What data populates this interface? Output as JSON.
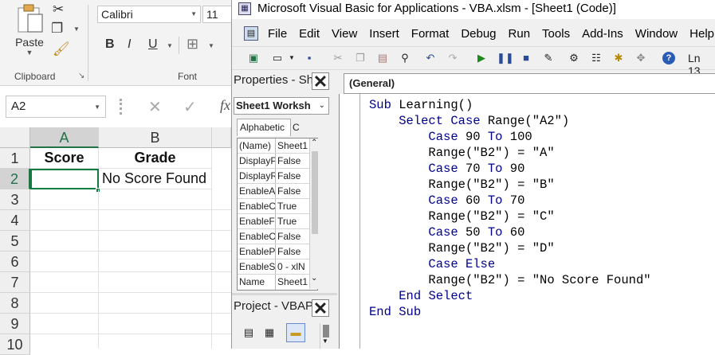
{
  "excel": {
    "clipboard_group": "Clipboard",
    "font_group": "Font",
    "paste_label": "Paste",
    "font_name": "Calibri",
    "font_size": "11",
    "name_box": "A2",
    "fx": "fx",
    "columns": [
      "A",
      "B"
    ],
    "rows": [
      "1",
      "2",
      "3",
      "4",
      "5",
      "6",
      "7",
      "8",
      "9",
      "10"
    ],
    "cells": {
      "A1": "Score",
      "B1": "Grade",
      "A2": "",
      "B2": "No Score Found"
    }
  },
  "vba": {
    "title": "Microsoft Visual Basic for Applications - VBA.xlsm - [Sheet1 (Code)]",
    "menus": [
      "File",
      "Edit",
      "View",
      "Insert",
      "Format",
      "Debug",
      "Run",
      "Tools",
      "Add-Ins",
      "Window",
      "Help"
    ],
    "status": "Ln 13",
    "properties_title": "Properties - Sh",
    "object_selector": "Sheet1 Worksh",
    "tabs": [
      "Alphabetic",
      "C"
    ],
    "properties": [
      {
        "name": "(Name)",
        "value": "Sheet1"
      },
      {
        "name": "DisplayP",
        "value": "False"
      },
      {
        "name": "DisplayR",
        "value": "False"
      },
      {
        "name": "EnableA",
        "value": "False"
      },
      {
        "name": "EnableC",
        "value": "True"
      },
      {
        "name": "EnableF",
        "value": "True"
      },
      {
        "name": "EnableO",
        "value": "False"
      },
      {
        "name": "EnableP",
        "value": "False"
      },
      {
        "name": "EnableS",
        "value": "0 - xlN"
      },
      {
        "name": "Name",
        "value": "Sheet1"
      }
    ],
    "project_title": "Project - VBAP",
    "general_dropdown": "(General)",
    "code_lines": [
      "Sub Learning()",
      "    Select Case Range(\"A2\")",
      "        Case 90 To 100",
      "        Range(\"B2\") = \"A\"",
      "        Case 70 To 90",
      "        Range(\"B2\") = \"B\"",
      "        Case 60 To 70",
      "        Range(\"B2\") = \"C\"",
      "        Case 50 To 60",
      "        Range(\"B2\") = \"D\"",
      "        Case Else",
      "        Range(\"B2\") = \"No Score Found\"",
      "    End Select",
      "End Sub"
    ]
  },
  "colors": {
    "excel_green": "#217346",
    "selection": "#107c41",
    "vba_keyword": "#00008b"
  }
}
